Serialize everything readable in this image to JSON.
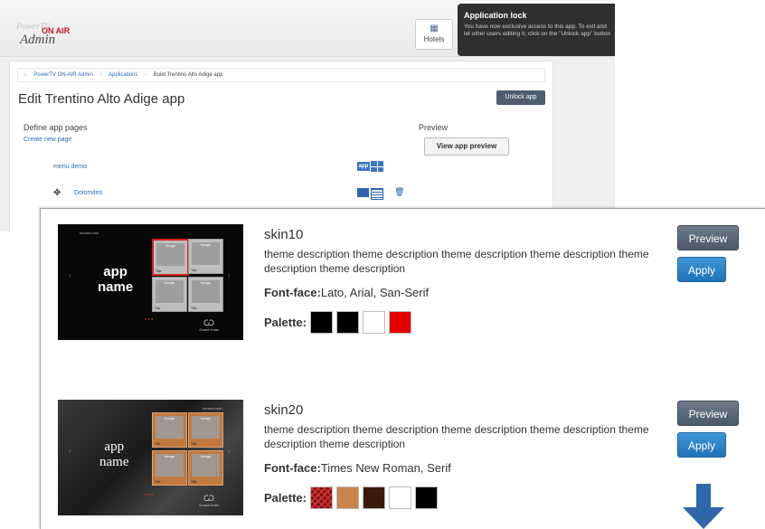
{
  "admin": {
    "logo": {
      "line1": "PowerTV",
      "line2": "ON AIR",
      "line3": "Admin"
    },
    "hotels_label": "Hotels",
    "lock_tip": {
      "title": "Application lock",
      "text": "You have now exclusive access to this app. To exit and let other users editing it, click on the \"Unlock app\" button"
    },
    "breadcrumb": [
      "PowerTV ON-AIR Admin",
      "Applications",
      "Build Trentino Alto Adige app"
    ],
    "page_title": "Edit Trentino Alto Adige app",
    "unlock_label": "Unlock app",
    "define_label": "Define app pages",
    "create_link": "Create new page",
    "preview_label": "Preview",
    "view_preview_label": "View app preview",
    "pages": [
      {
        "label": "menu demo",
        "badge": "app"
      },
      {
        "label": "Dolomites"
      }
    ]
  },
  "skins": [
    {
      "name": "skin10",
      "description": "theme description theme description theme description theme description theme description theme description",
      "font_face_label": "Font-face:",
      "font_face_value": "Lato, Arial, San-Serif",
      "palette_label": "Palette:",
      "palette": [
        "#000000",
        "#000000",
        "#ffffff",
        "#e20000"
      ],
      "preview_label": "Preview",
      "apply_label": "Apply",
      "thumb": {
        "breadcrumb": "breadcrumb",
        "app_name_1": "app",
        "app_name_2": "name",
        "tile_label": "Image",
        "tile_title": "Title",
        "hotel": "Grand Hotel"
      }
    },
    {
      "name": "skin20",
      "description": "theme description theme description theme description theme description theme description theme description",
      "font_face_label": "Font-face:",
      "font_face_value": "Times New Roman, Serif",
      "palette_label": "Palette:",
      "palette": [
        "#7a1010",
        "#c8844c",
        "#3a1a0a",
        "#ffffff",
        "#000000"
      ],
      "preview_label": "Preview",
      "apply_label": "Apply",
      "thumb": {
        "breadcrumb": "breadcrumb",
        "app_name_1": "app",
        "app_name_2": "name",
        "tile_label": "Image",
        "tile_title": "Title",
        "hotel": "Grand Hotel"
      }
    }
  ],
  "colors": {
    "accent_blue": "#1f73b8",
    "preview_gray": "#4b5866",
    "down_arrow": "#2f66aa"
  },
  "icons": [
    "home-icon",
    "hotels-icon",
    "move-icon",
    "grid-icon",
    "list-icon",
    "trash-icon",
    "arrow-down-icon"
  ]
}
